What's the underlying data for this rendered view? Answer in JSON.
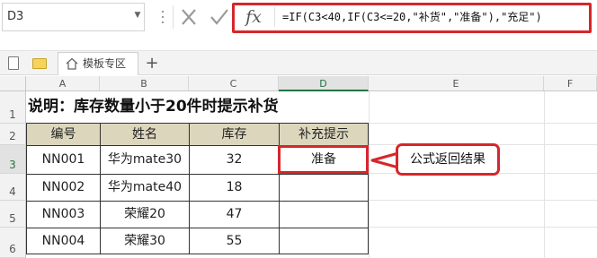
{
  "formula_bar": {
    "name_box": "D3",
    "formula": "=IF(C3<40,IF(C3<=20,\"补货\",\"准备\"),\"充足\")"
  },
  "tabs": {
    "active_tab_label": "模板专区"
  },
  "sheet": {
    "columns": [
      "A",
      "B",
      "C",
      "D",
      "E",
      "F"
    ],
    "rows": [
      "1",
      "2",
      "3",
      "4",
      "5",
      "6"
    ],
    "selected_cell": "D3",
    "title": "说明：库存数量小于20件时提示补货",
    "headers": [
      "编号",
      "姓名",
      "库存",
      "补充提示"
    ],
    "data": [
      [
        "NN001",
        "华为mate30",
        "32",
        "准备"
      ],
      [
        "NN002",
        "华为mate40",
        "18",
        ""
      ],
      [
        "NN003",
        "荣耀20",
        "47",
        ""
      ],
      [
        "NN004",
        "荣耀30",
        "55",
        ""
      ]
    ]
  },
  "callout": {
    "text": "公式返回结果"
  },
  "colors": {
    "highlight_red": "#d7262a",
    "header_fill": "#dcd6bd",
    "excel_green": "#217346"
  }
}
